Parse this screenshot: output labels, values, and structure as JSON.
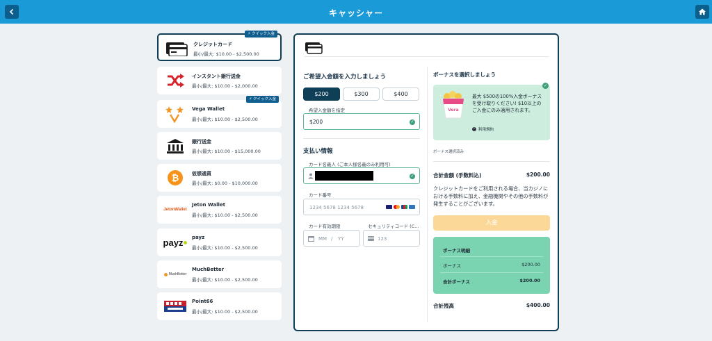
{
  "header": {
    "title": "キャッシャー",
    "back_icon": "chevron-left-icon",
    "home_icon": "home-icon"
  },
  "methods": [
    {
      "name": "クレジットカード",
      "range": "最小/最大: $10.00 - $2,500.00",
      "badge": "⚡ クイック入金",
      "icon": "credit-card-icon",
      "selected": true
    },
    {
      "name": "インスタント銀行送金",
      "range": "最小/最大: $10.00 - $2,000.00",
      "icon": "shuffle-icon"
    },
    {
      "name": "Vega Wallet",
      "range": "最小/最大: $10.00 - $2,500.00",
      "badge": "⚡ クイック入金",
      "icon": "vega-wallet-logo"
    },
    {
      "name": "銀行送金",
      "range": "最小/最大: $10.00 - $15,000.00",
      "icon": "bank-icon"
    },
    {
      "name": "仮想通貨",
      "range": "最小/最大: $0.00 - $10,000.00",
      "icon": "bitcoin-icon"
    },
    {
      "name": "Jeton Wallet",
      "range": "最小/最大: $10.00 - $2,500.00",
      "icon": "jeton-logo",
      "logo_text": "JetonWallet"
    },
    {
      "name": "payz",
      "range": "最小/最大: $10.00 - $2,500.00",
      "icon": "payz-logo",
      "logo_text": "payz"
    },
    {
      "name": "MuchBetter",
      "range": "最小/最大: $10.00 - $2,500.00",
      "icon": "muchbetter-logo",
      "logo_text": "MuchBetter"
    },
    {
      "name": "Point66",
      "range": "最小/最大: $10.00 - $2,500.00",
      "icon": "point66-logo"
    }
  ],
  "deposit": {
    "section_title": "ご希望入金額を入力しましょう",
    "amount_options": [
      "$200",
      "$300",
      "$400"
    ],
    "selected_amount": "$200",
    "custom_amount_label": "希望入金額を指定",
    "custom_amount_value": "$200"
  },
  "payment": {
    "section_title": "支払い情報",
    "cardholder_label": "カード名義人 (ご本人様名義のみ利用可)",
    "card_number_label": "カード番号",
    "card_number_placeholder": "1234 5678 1234 5678",
    "expiry_label": "カード有効期限",
    "expiry_mm": "MM",
    "expiry_sep": "/",
    "expiry_yy": "YY",
    "cvc_label": "セキュリティコード (C...",
    "cvc_placeholder": "123",
    "card_brand_icons": [
      "visa-icon",
      "mastercard-icon",
      "jcb-icon",
      "amex-icon"
    ]
  },
  "bonus": {
    "section_title": "ボーナスを選択しましょう",
    "offer_text": "最大 $500の100%入金ボーナスを受け取りください! $10以上のご入金にのみ適用されます。",
    "terms_label": "利用規約",
    "selected_note": "ボーナス選択済み"
  },
  "totals": {
    "total_label": "合計金額 (手数料込)",
    "total_value": "$200.00",
    "notice": "クレジットカードをご利用される場合、当カジノにおける手数料に加え、金融機関やその他の手数料が発生することがございます。",
    "deposit_button": "入金",
    "summary_title": "ボーナス明細",
    "bonus_label": "ボーナス",
    "bonus_value": "$200.00",
    "total_bonus_label": "合計ボーナス",
    "total_bonus_value": "$200.00",
    "balance_label": "合計残高",
    "balance_value": "$400.00"
  },
  "colors": {
    "header": "#1a9ad6",
    "accent_dark": "#0f3e57",
    "bonus_card": "#cdeede",
    "summary": "#7bd4b1",
    "deposit_button_disabled": "#fbd898"
  }
}
